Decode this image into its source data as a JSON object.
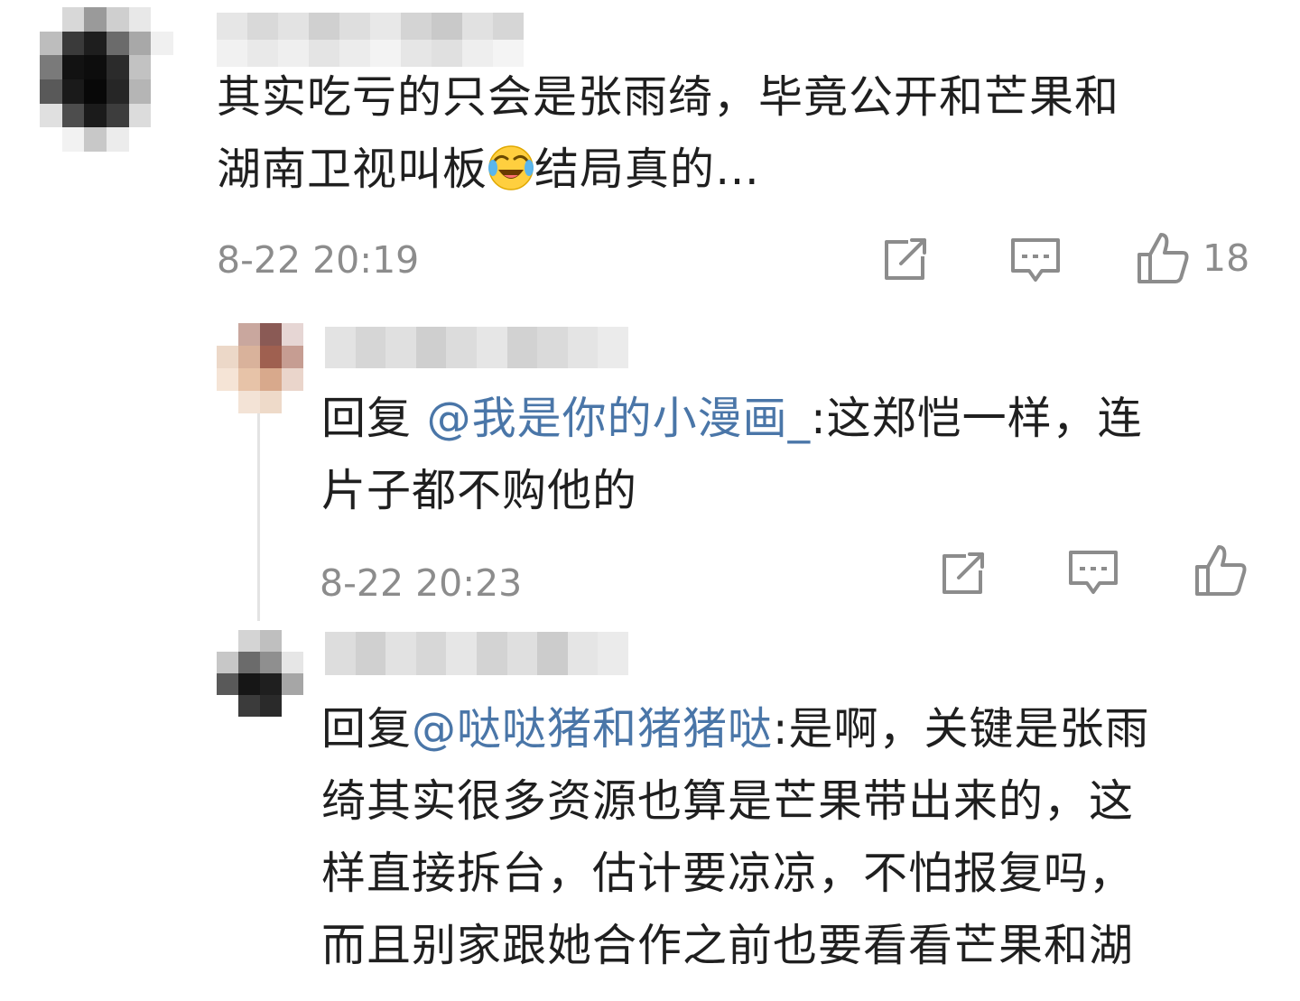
{
  "comments": [
    {
      "text_parts": [
        "其实吃亏的只会是张雨绮，毕竟公开和芒果和\n湖南卫视叫板",
        "结局真的…"
      ],
      "emoji": "laugh-cry-emoji",
      "timestamp": "8-22 20:19",
      "like_count": "18",
      "icons": {
        "share": "share-icon",
        "reply": "reply-icon",
        "like": "thumbs-up-icon"
      }
    },
    {
      "reply_prefix": "回复 ",
      "mention": "@我是你的小漫画_",
      "text": ":这郑恺一样，连\n片子都不购他的",
      "timestamp": "8-22 20:23",
      "icons": {
        "share": "share-icon",
        "reply": "reply-icon",
        "like": "thumbs-up-icon"
      }
    },
    {
      "reply_prefix": "回复",
      "mention": "@哒哒猪和猪猪哒",
      "text": ":是啊，关键是张雨\n绮其实很多资源也算是芒果带出来的，这\n样直接拆台，估计要凉凉，不怕报复吗，\n而且别家跟她合作之前也要看看芒果和湖"
    }
  ],
  "colors": {
    "text": "#1f1f1f",
    "mention": "#4a76a8",
    "meta": "#8c8c8c"
  }
}
